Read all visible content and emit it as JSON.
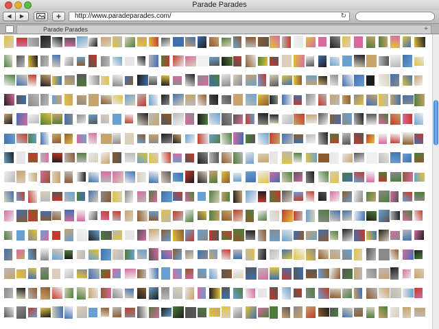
{
  "window": {
    "title": "Parade Parades"
  },
  "toolbar": {
    "back_icon": "back-arrow-icon",
    "forward_icon": "forward-arrow-icon",
    "screenshot_icon": "screenshot-icon",
    "add_bookmark_label": "+",
    "address": "http://www.paradeparades.com/",
    "reload_icon": "reload-icon",
    "search_value": ""
  },
  "tabs": [
    {
      "label": "Parade Parades"
    }
  ],
  "grid": {
    "rows": 15,
    "columns": 35
  },
  "colors": {
    "thumb_palette": [
      "#1c1c1c",
      "#555555",
      "#8a8a8a",
      "#b9b9b9",
      "#d9cfba",
      "#c7a36d",
      "#8c5a2f",
      "#c23a2b",
      "#e1c23e",
      "#3f6fb0",
      "#6aa0cf",
      "#e6e6e6",
      "#4d7d3a",
      "#d86aa0",
      "#f0f0f0"
    ],
    "scroll_thumb": "#4f8ad9"
  }
}
